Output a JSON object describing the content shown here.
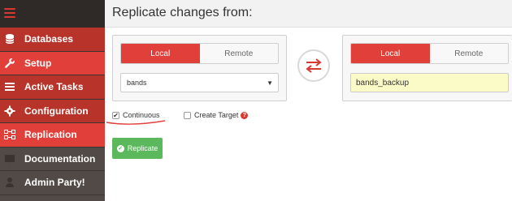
{
  "sidebar": {
    "items": [
      {
        "label": "Databases",
        "icon": "database-icon"
      },
      {
        "label": "Setup",
        "icon": "wrench-icon"
      },
      {
        "label": "Active Tasks",
        "icon": "tasks-icon"
      },
      {
        "label": "Configuration",
        "icon": "gear-icon"
      },
      {
        "label": "Replication",
        "icon": "replication-icon"
      },
      {
        "label": "Documentation",
        "icon": "book-icon"
      },
      {
        "label": "Admin Party!",
        "icon": "user-icon"
      }
    ]
  },
  "header": {
    "title": "Replicate changes from:"
  },
  "source": {
    "tab_local": "Local",
    "tab_remote": "Remote",
    "selected_db": "bands"
  },
  "target": {
    "tab_local": "Local",
    "tab_remote": "Remote",
    "db_name": "bands_backup"
  },
  "options": {
    "continuous_label": "Continuous",
    "continuous_checked": true,
    "create_target_label": "Create Target",
    "create_target_checked": false
  },
  "actions": {
    "replicate_label": "Replicate"
  },
  "colors": {
    "accent": "#e1403a",
    "sidebar_dark": "#514a46",
    "success": "#5cb85c",
    "input_highlight": "#fbfbc7"
  }
}
